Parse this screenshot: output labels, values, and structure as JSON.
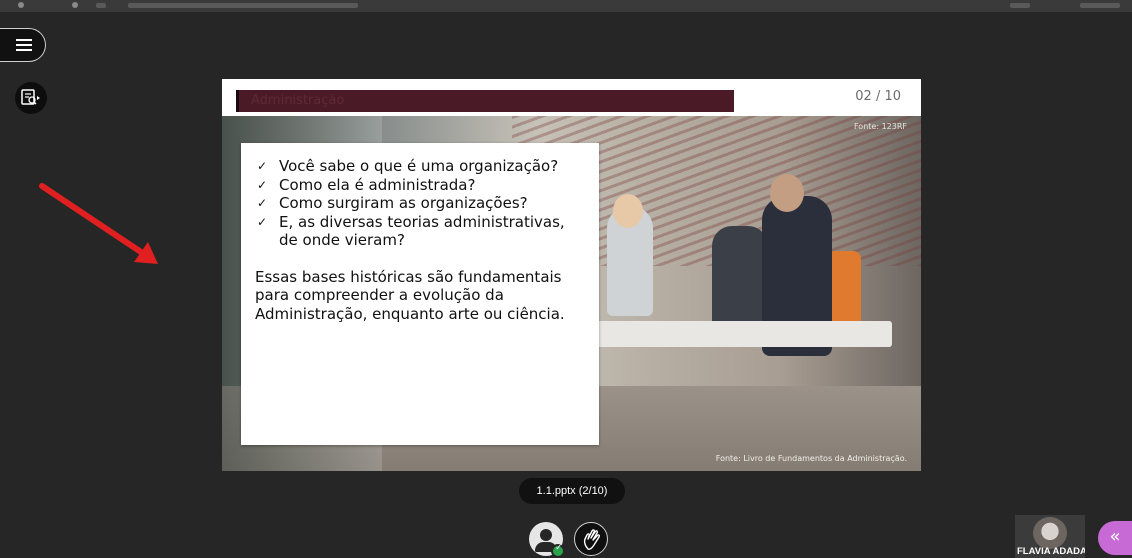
{
  "slide": {
    "title": "Administração",
    "page_number": "02 / 10",
    "bullets": [
      "Você sabe o que é uma organização?",
      "Como ela é administrada?",
      "Como surgiram as organizações?",
      "E, as diversas teorias administrativas, de onde vieram?"
    ],
    "bullet_mark": "✓",
    "paragraph": "Essas bases históricas são fundamentais para compreender a evolução da Administração, enquanto arte ou ciência.",
    "photo_credit_top": "Fonte: 123RF",
    "photo_credit_bottom": "Fonte: Livro de Fundamentos da Administração."
  },
  "presentation": {
    "file_label": "1.1.pptx  (2/10)"
  },
  "participant": {
    "name": "FLAVIA ADADA"
  },
  "icons": {
    "menu": "hamburger-menu-icon",
    "notes": "slide-notes-icon",
    "avatar": "user-avatar-icon",
    "raise_hand": "raise-hand-icon",
    "collapse": "chevron-double-left-icon",
    "collapse_glyph": "«"
  },
  "colors": {
    "background": "#262626",
    "title_bar": "#4a1a27",
    "collapse_button": "#c86ad6",
    "status_ok": "#2aa44a",
    "annotation_arrow": "#e02020"
  }
}
